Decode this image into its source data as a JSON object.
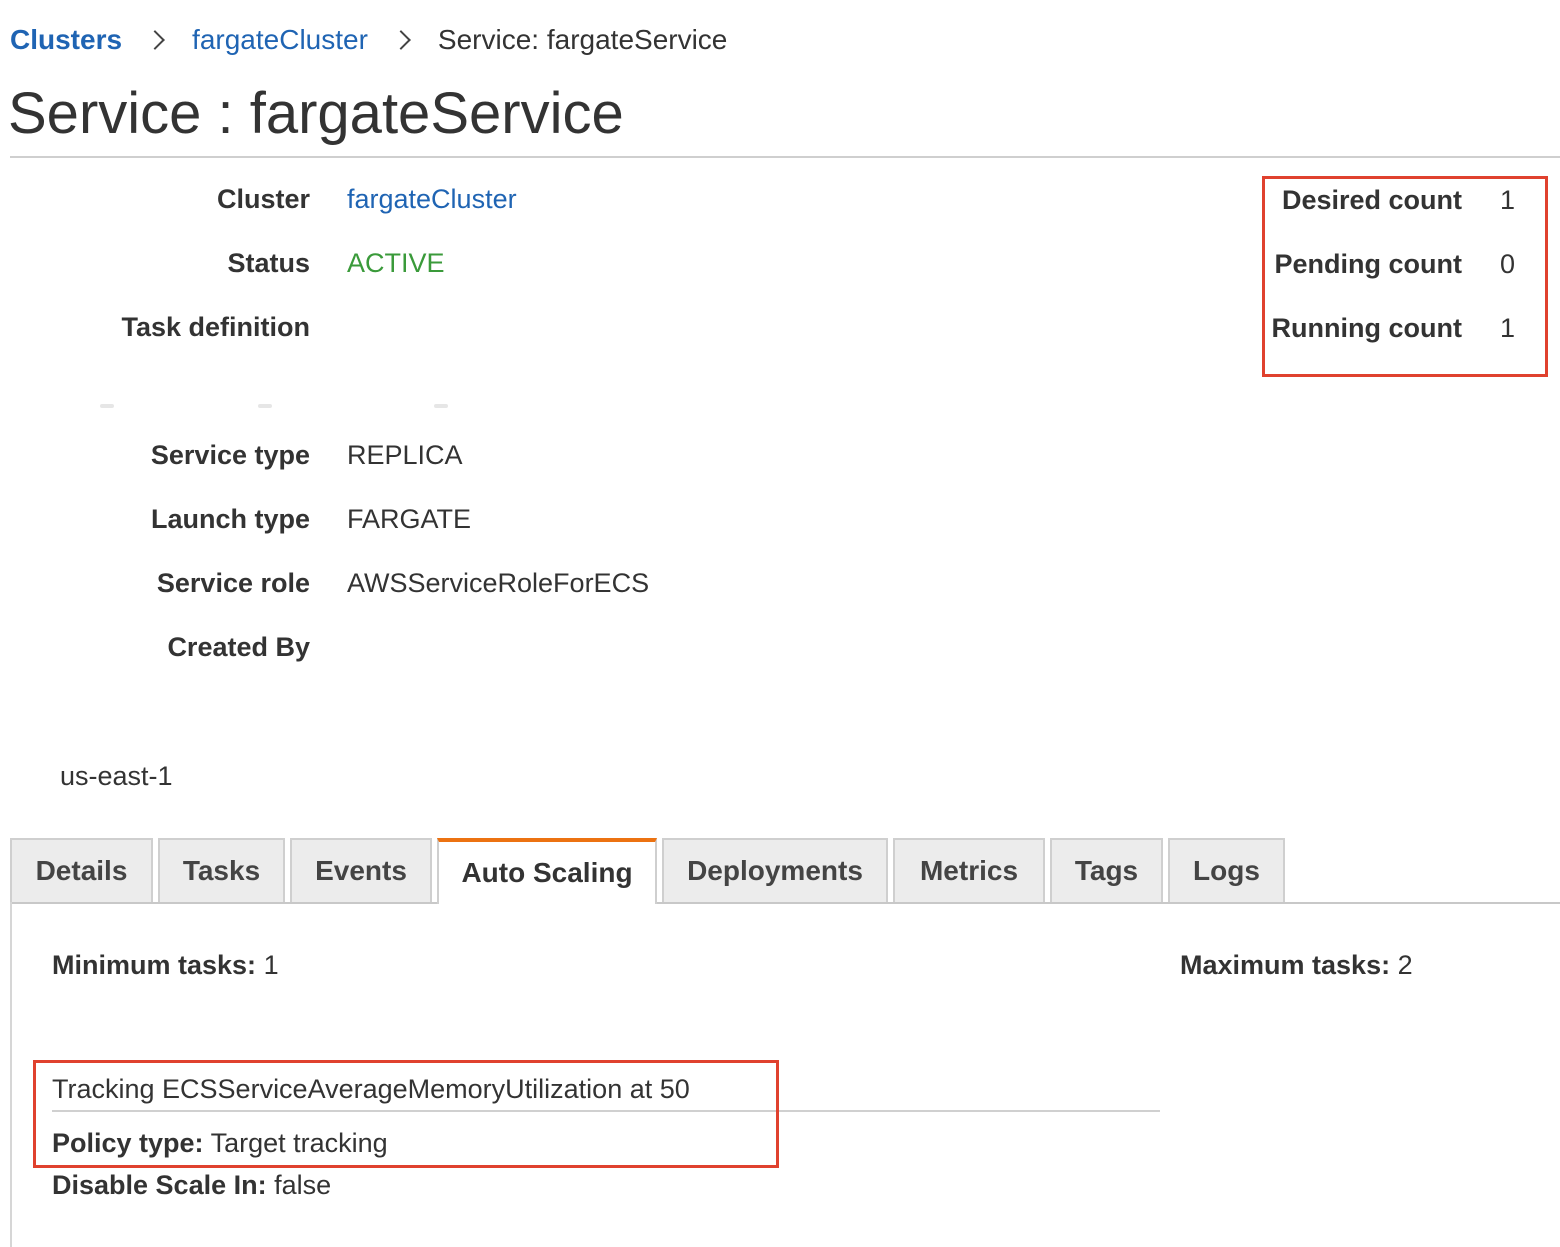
{
  "breadcrumb": {
    "clusters": "Clusters",
    "cluster": "fargateCluster",
    "current": "Service: fargateService"
  },
  "page_title": "Service : fargateService",
  "info": {
    "cluster_label": "Cluster",
    "cluster_value": "fargateCluster",
    "status_label": "Status",
    "status_value": "ACTIVE",
    "task_definition_label": "Task definition",
    "service_type_label": "Service type",
    "service_type_value": "REPLICA",
    "launch_type_label": "Launch type",
    "launch_type_value": "FARGATE",
    "service_role_label": "Service role",
    "service_role_value": "AWSServiceRoleForECS",
    "created_by_label": "Created By",
    "region": "us-east-1"
  },
  "counts": {
    "desired_label": "Desired count",
    "desired_value": "1",
    "pending_label": "Pending count",
    "pending_value": "0",
    "running_label": "Running count",
    "running_value": "1"
  },
  "tabs": [
    {
      "label": "Details"
    },
    {
      "label": "Tasks"
    },
    {
      "label": "Events"
    },
    {
      "label": "Auto Scaling"
    },
    {
      "label": "Deployments"
    },
    {
      "label": "Metrics"
    },
    {
      "label": "Tags"
    },
    {
      "label": "Logs"
    }
  ],
  "active_tab": "Auto Scaling",
  "autoscaling": {
    "min_label": "Minimum tasks:",
    "min_value": "1",
    "max_label": "Maximum tasks:",
    "max_value": "2",
    "policy_title": "Tracking ECSServiceAverageMemoryUtilization at 50",
    "policy_type_label": "Policy type:",
    "policy_type_value": "Target tracking",
    "disable_scale_in_label": "Disable Scale In:",
    "disable_scale_in_value": "false"
  },
  "colors": {
    "link": "#1f64b3",
    "status_active": "#3a9a3a",
    "highlight_box": "#e0412e",
    "active_tab_accent": "#ec7211"
  }
}
